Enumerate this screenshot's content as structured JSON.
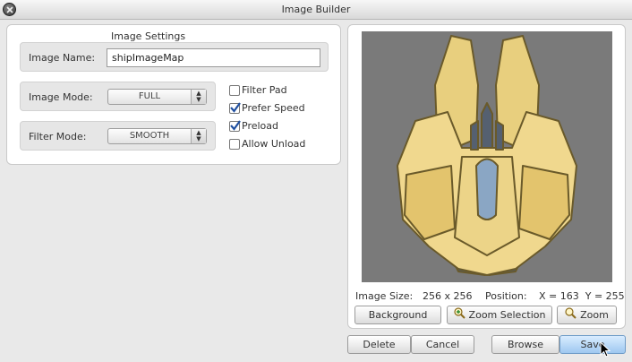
{
  "window": {
    "title": "Image Builder"
  },
  "settings": {
    "heading": "Image Settings",
    "image_name_label": "Image Name:",
    "image_name_value": "shipImageMap",
    "image_mode_label": "Image Mode:",
    "image_mode_value": "FULL",
    "filter_mode_label": "Filter Mode:",
    "filter_mode_value": "SMOOTH",
    "options": [
      {
        "label": "Filter Pad",
        "checked": false
      },
      {
        "label": "Prefer Speed",
        "checked": true
      },
      {
        "label": "Preload",
        "checked": true
      },
      {
        "label": "Allow Unload",
        "checked": false
      }
    ]
  },
  "preview": {
    "image_size_label": "Image Size:",
    "image_size_value": "256 x 256",
    "position_label": "Position:",
    "position_value": "X = 163  Y = 255",
    "background_button": "Background",
    "zoom_selection_button": "Zoom Selection",
    "zoom_button": "Zoom"
  },
  "footer": {
    "delete_button": "Delete",
    "cancel_button": "Cancel",
    "browse_button": "Browse",
    "save_button": "Save"
  },
  "colors": {
    "preview_bg": "#7a7a7a",
    "save_accent": "#9ec8f0"
  }
}
